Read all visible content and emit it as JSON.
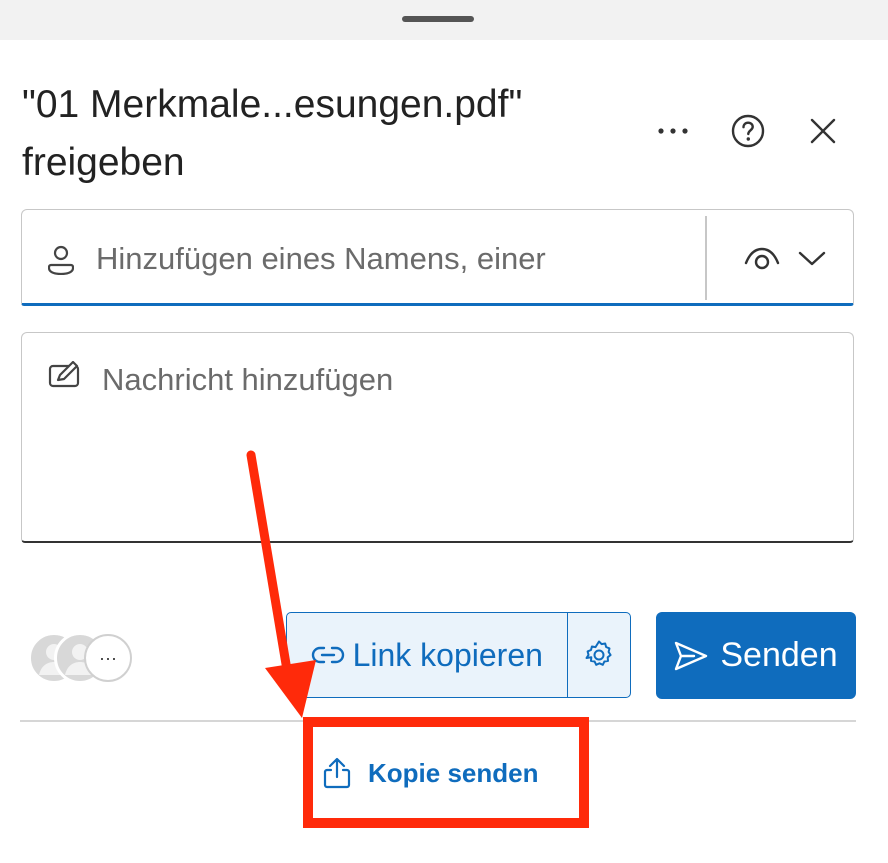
{
  "sheet": {
    "title_line1": "\"01 Merkmale...esungen.pdf\"",
    "title_line2": "freigeben",
    "more_icon": "more-horizontal-icon",
    "help_icon": "help-circle-icon",
    "close_icon": "close-icon"
  },
  "people_picker": {
    "placeholder": "Hinzufügen eines Namens, einer",
    "value": "",
    "person_icon": "person-icon",
    "permission_icon": "eye-icon",
    "dropdown_icon": "chevron-down-icon"
  },
  "message": {
    "placeholder": "Nachricht hinzufügen",
    "value": "",
    "icon": "edit-icon"
  },
  "footer": {
    "avatars_more": "···",
    "copy_link_label": "Link kopieren",
    "copy_link_icon": "link-icon",
    "link_settings_icon": "gear-icon",
    "send_label": "Senden",
    "send_icon": "send-icon",
    "send_copy_label": "Kopie senden",
    "send_copy_icon": "share-upload-icon"
  },
  "annotation": {
    "color": "#ff2a0a"
  },
  "colors": {
    "accent": "#0f6cbd",
    "accent_light": "#eaf3fb"
  }
}
